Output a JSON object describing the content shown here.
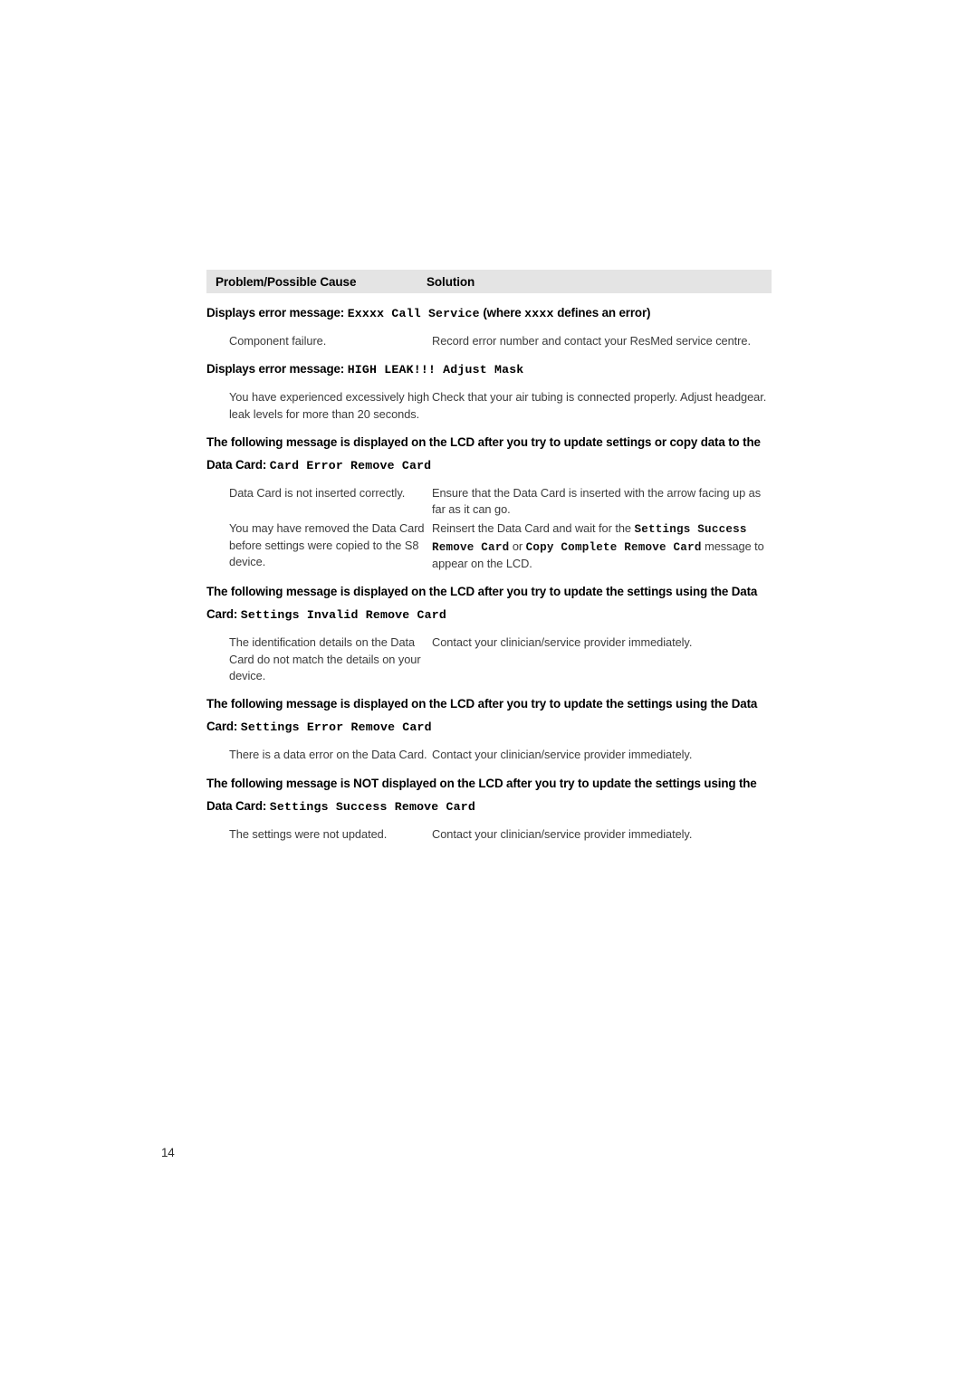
{
  "table": {
    "header": {
      "col_cause": "Problem/Possible Cause",
      "col_solution": "Solution"
    },
    "sections": [
      {
        "heading_runs": [
          {
            "text": "Displays error message: ",
            "style": "sans"
          },
          {
            "text": "Exxxx Call Service",
            "style": "mono"
          },
          {
            "text": " (where ",
            "style": "sans"
          },
          {
            "text": "xxxx",
            "style": "mono"
          },
          {
            "text": " defines an error)",
            "style": "sans"
          }
        ],
        "rows": [
          {
            "cause_runs": [
              {
                "text": "Component failure.",
                "style": "plain"
              }
            ],
            "solution_runs": [
              {
                "text": "Record error number and contact your ResMed service centre.",
                "style": "plain"
              }
            ]
          }
        ]
      },
      {
        "heading_runs": [
          {
            "text": "Displays error message: ",
            "style": "sans"
          },
          {
            "text": "HIGH LEAK!!! Adjust Mask",
            "style": "mono"
          }
        ],
        "rows": [
          {
            "cause_runs": [
              {
                "text": "You have experienced excessively high leak levels for more than 20 seconds.",
                "style": "plain"
              }
            ],
            "solution_runs": [
              {
                "text": "Check that your air tubing is connected properly. Adjust headgear.",
                "style": "plain"
              }
            ]
          }
        ]
      },
      {
        "heading_runs": [
          {
            "text": "The following message is displayed on the LCD after you try to update settings or copy data to the Data Card: ",
            "style": "sans"
          },
          {
            "text": "Card Error Remove Card",
            "style": "mono"
          }
        ],
        "rows": [
          {
            "cause_runs": [
              {
                "text": "Data Card is not inserted correctly.",
                "style": "plain"
              }
            ],
            "solution_runs": [
              {
                "text": "Ensure that the Data Card is inserted with the arrow facing up as far as it can go.",
                "style": "plain"
              }
            ]
          },
          {
            "cause_runs": [
              {
                "text": "You may have removed the Data Card before settings were copied to the S8 device.",
                "style": "plain"
              }
            ],
            "solution_runs": [
              {
                "text": "Reinsert the Data Card and wait for the ",
                "style": "plain"
              },
              {
                "text": "Settings Success Remove Card",
                "style": "mono"
              },
              {
                "text": " or ",
                "style": "plain"
              },
              {
                "text": "Copy Complete Remove Card",
                "style": "mono"
              },
              {
                "text": " message to appear on the LCD.",
                "style": "plain"
              }
            ]
          }
        ]
      },
      {
        "heading_runs": [
          {
            "text": "The following message is displayed on the LCD after you try to update the settings using the Data Card: ",
            "style": "sans"
          },
          {
            "text": "Settings Invalid Remove Card",
            "style": "mono"
          }
        ],
        "rows": [
          {
            "cause_runs": [
              {
                "text": "The identification details on the Data Card do not match the details on your device.",
                "style": "plain"
              }
            ],
            "solution_runs": [
              {
                "text": "Contact your clinician/service provider immediately.",
                "style": "plain"
              }
            ]
          }
        ]
      },
      {
        "heading_runs": [
          {
            "text": "The following message is displayed on the LCD after you try to update the settings using the Data Card: ",
            "style": "sans"
          },
          {
            "text": "Settings Error Remove Card",
            "style": "mono"
          }
        ],
        "rows": [
          {
            "cause_runs": [
              {
                "text": "There is a data error on the Data Card.",
                "style": "plain"
              }
            ],
            "solution_runs": [
              {
                "text": "Contact your clinician/service provider immediately.",
                "style": "plain"
              }
            ]
          }
        ]
      },
      {
        "heading_runs": [
          {
            "text": "The following message is NOT displayed on the LCD after you try to update the settings using the Data Card: ",
            "style": "sans"
          },
          {
            "text": "Settings Success Remove Card",
            "style": "mono"
          }
        ],
        "rows": [
          {
            "cause_runs": [
              {
                "text": "The settings were not updated.",
                "style": "plain"
              }
            ],
            "solution_runs": [
              {
                "text": "Contact your clinician/service provider immediately.",
                "style": "plain"
              }
            ]
          }
        ]
      }
    ]
  },
  "footer": {
    "page_number": "14"
  },
  "colors": {
    "header_band": "#e4e4e4",
    "heading_text": "#000000",
    "body_text": "#3b3b3b",
    "page_background": "#ffffff"
  }
}
